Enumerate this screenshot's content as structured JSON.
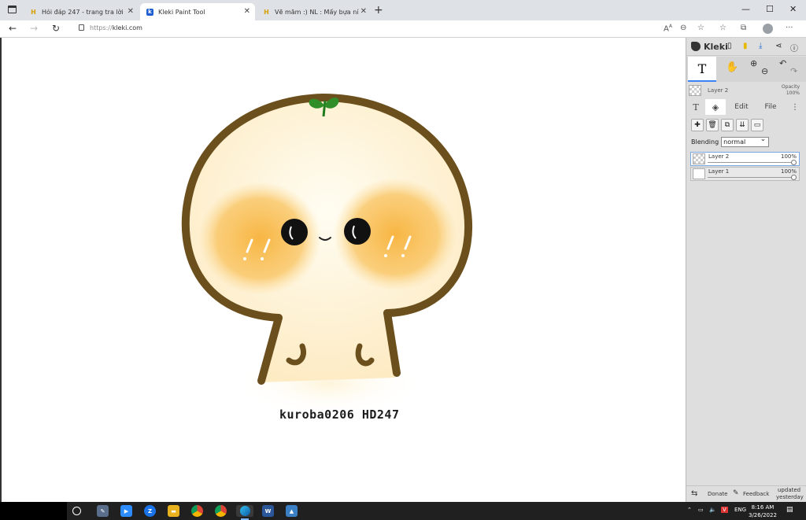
{
  "browser": {
    "tabs": [
      {
        "title": "Hỏi đáp 247 - trang tra lời",
        "favicon": "H",
        "active": false
      },
      {
        "title": "Kleki Paint Tool",
        "favicon": "k",
        "active": true
      },
      {
        "title": "Vẽ măm :) NL : Mấy bựa ní nỏ cớ",
        "favicon": "H",
        "active": false
      }
    ],
    "new_tab": "+",
    "window": {
      "minimize": "—",
      "maximize": "☐",
      "close": "✕"
    },
    "address": {
      "scheme": "https://",
      "host": "kleki.com"
    }
  },
  "canvas": {
    "caption": "kuroba0206   HD247"
  },
  "kleki": {
    "logo_text": "Kleki",
    "layer_preview_name": "Layer 2",
    "opacity_label": "Opacity",
    "opacity_value": "100%",
    "tabs": {
      "edit": "Edit",
      "file": "File"
    },
    "blending_label": "Blending",
    "blending_value": "normal",
    "layers": [
      {
        "name": "Layer 2",
        "opacity": "100%",
        "selected": true
      },
      {
        "name": "Layer 1",
        "opacity": "100%",
        "selected": false
      }
    ],
    "footer": {
      "donate": "Donate",
      "feedback": "Feedback",
      "updated": "updated",
      "updated_when": "yesterday"
    }
  },
  "taskbar": {
    "lang": "ENG",
    "time": "8:16 AM",
    "date": "3/26/2022"
  }
}
